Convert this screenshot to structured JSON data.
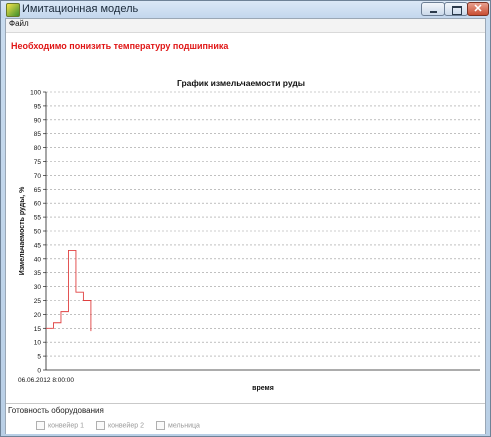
{
  "window": {
    "title": "Имитационная модель"
  },
  "menu": {
    "file": "Файл"
  },
  "alert": {
    "message": "Необходимо понизить температуру подшипника"
  },
  "equipment": {
    "title": "Готовность оборудования",
    "items": [
      "конвейер 1",
      "конвейер 2",
      "мельница"
    ]
  },
  "colors": {
    "series": "#e04040",
    "warning": "#e01616"
  },
  "chart_data": {
    "type": "line",
    "title": "График измельчаемости руды",
    "xlabel": "время",
    "ylabel": "Измельчаемость руды, %",
    "ylim": [
      0,
      100
    ],
    "yticks": [
      0,
      5,
      10,
      15,
      20,
      25,
      30,
      35,
      40,
      45,
      50,
      55,
      60,
      65,
      70,
      75,
      80,
      85,
      90,
      95,
      100
    ],
    "x_start_label": "06.06.2012 8:00:00",
    "grid": true,
    "step": true,
    "series": [
      {
        "x": [
          0,
          1,
          2,
          3,
          4,
          5
        ],
        "y": [
          15,
          17,
          21,
          43,
          28,
          25
        ],
        "end_y": 14
      }
    ],
    "x_max": 58
  }
}
